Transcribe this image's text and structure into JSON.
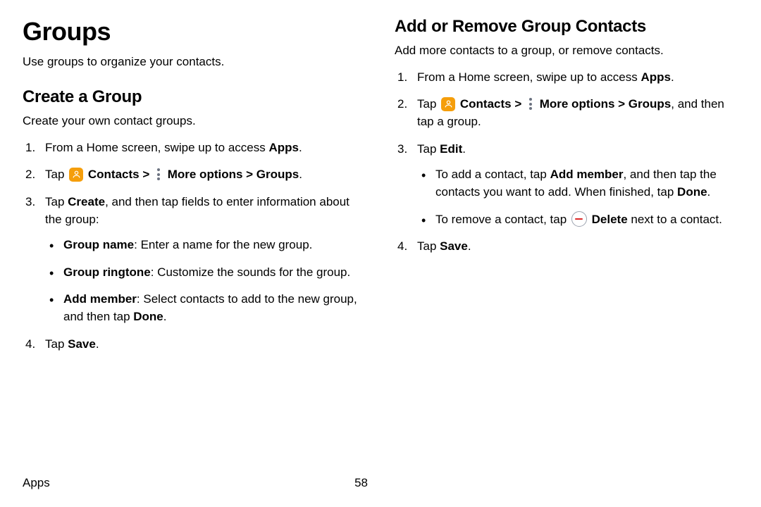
{
  "left": {
    "h1": "Groups",
    "intro": "Use groups to organize your contacts.",
    "h2": "Create a Group",
    "sub": "Create your own contact groups.",
    "s1a": "From a Home screen, swipe up to access ",
    "s1b": "Apps",
    "s1c": ".",
    "s2a": "Tap ",
    "s2b": "Contacts > ",
    "s2c": "More options > Groups",
    "s2d": ".",
    "s3a": "Tap ",
    "s3b": "Create",
    "s3c": ", and then tap fields to enter information about the group:",
    "b1a": "Group name",
    "b1b": ": Enter a name for the new group.",
    "b2a": "Group ringtone",
    "b2b": ": Customize the sounds for the group.",
    "b3a": "Add member",
    "b3b": ": Select contacts to add to the new group, and then tap ",
    "b3c": "Done",
    "b3d": ".",
    "s4a": "Tap ",
    "s4b": "Save",
    "s4c": "."
  },
  "right": {
    "h2": "Add or Remove Group Contacts",
    "sub": "Add more contacts to a group, or remove contacts.",
    "s1a": "From a Home screen, swipe up to access ",
    "s1b": "Apps",
    "s1c": ".",
    "s2a": "Tap ",
    "s2b": "Contacts > ",
    "s2c": "More options > Groups",
    "s2d": ", and then tap a group.",
    "s3a": "Tap ",
    "s3b": "Edit",
    "s3c": ".",
    "b1a": "To add a contact, tap ",
    "b1b": "Add member",
    "b1c": ", and then tap the contacts you want to add. When finished, tap ",
    "b1d": "Done",
    "b1e": ".",
    "b2a": "To remove a contact, tap ",
    "b2b": "Delete",
    "b2c": " next to a contact.",
    "s4a": "Tap ",
    "s4b": "Save",
    "s4c": "."
  },
  "footer": {
    "section": "Apps",
    "page": "58"
  }
}
